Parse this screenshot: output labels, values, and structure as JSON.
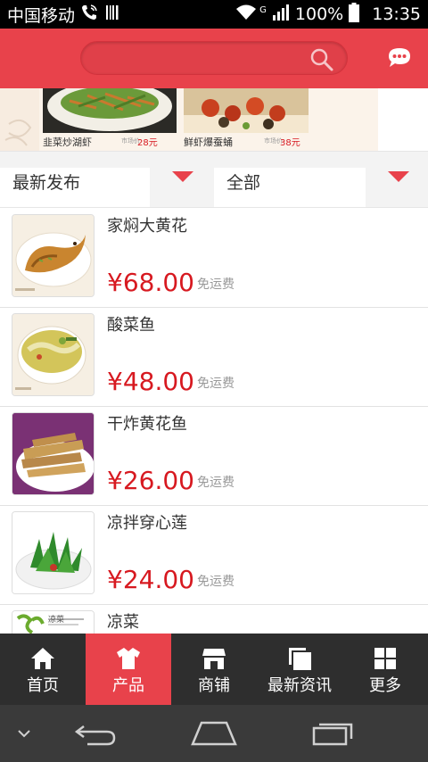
{
  "status_bar": {
    "carrier": "中国移动",
    "battery": "100%",
    "time": "13:35",
    "network": "G"
  },
  "search": {
    "placeholder": ""
  },
  "banner": {
    "items": [
      {
        "name": "韭菜炒湖虾",
        "price_label": "市场价",
        "price": "28元"
      },
      {
        "name": "鲜虾爆蚕蛹",
        "price_label": "市场价",
        "price": "38元"
      }
    ]
  },
  "filters": {
    "sort": {
      "label": "最新发布"
    },
    "category": {
      "label": "全部"
    }
  },
  "products": [
    {
      "name": "家焖大黄花",
      "price": "¥68.00",
      "shipping": "免运费",
      "thumb_caption": "家焖大黄花"
    },
    {
      "name": "酸菜鱼",
      "price": "¥48.00",
      "shipping": "免运费",
      "thumb_caption": "酸菜鱼"
    },
    {
      "name": "干炸黄花鱼",
      "price": "¥26.00",
      "shipping": "免运费",
      "thumb_caption": ""
    },
    {
      "name": "凉拌穿心莲",
      "price": "¥24.00",
      "shipping": "免运费",
      "thumb_caption": ""
    },
    {
      "name": "凉菜",
      "price": "",
      "shipping": "",
      "thumb_caption": "凉菜"
    }
  ],
  "bottom_nav": [
    {
      "label": "首页",
      "icon": "home-icon",
      "active": false
    },
    {
      "label": "产品",
      "icon": "shirt-icon",
      "active": true
    },
    {
      "label": "商铺",
      "icon": "store-icon",
      "active": false
    },
    {
      "label": "最新资讯",
      "icon": "news-icon",
      "active": false
    },
    {
      "label": "更多",
      "icon": "grid-icon",
      "active": false
    }
  ],
  "colors": {
    "brand_red": "#e8424b",
    "price_red": "#d71920",
    "nav_dark": "#2e2e2e"
  }
}
